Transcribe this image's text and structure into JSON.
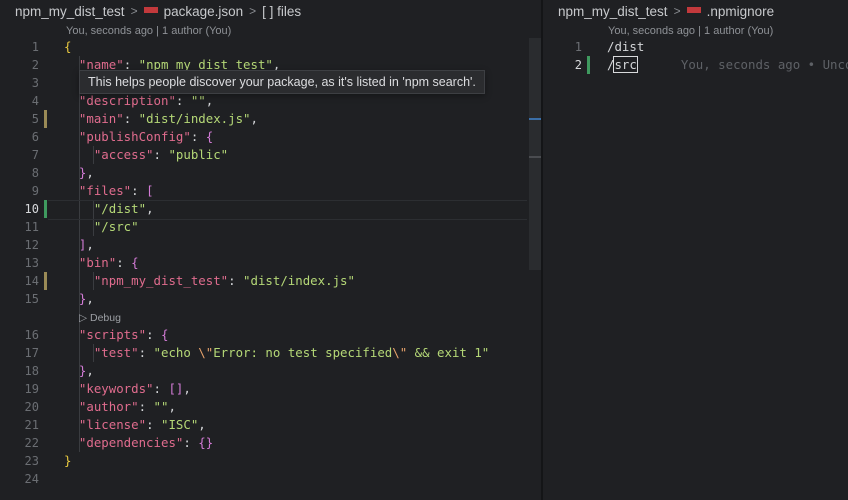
{
  "left": {
    "breadcrumb": {
      "folder": "npm_my_dist_test",
      "file": "package.json",
      "node": "[ ] files"
    },
    "blame_lens": "You, seconds ago | 1 author (You)",
    "hover_text": "This helps people discover your package, as it's listed in 'npm search'.",
    "codelens_debug": "▷ Debug",
    "lines": [
      {
        "n": "1"
      },
      {
        "n": "2"
      },
      {
        "n": "3"
      },
      {
        "n": "4"
      },
      {
        "n": "5"
      },
      {
        "n": "6"
      },
      {
        "n": "7"
      },
      {
        "n": "8"
      },
      {
        "n": "9"
      },
      {
        "n": "10"
      },
      {
        "n": "11"
      },
      {
        "n": "12"
      },
      {
        "n": "13"
      },
      {
        "n": "14"
      },
      {
        "n": "15"
      },
      {
        "n": "16"
      },
      {
        "n": "17"
      },
      {
        "n": "18"
      },
      {
        "n": "19"
      },
      {
        "n": "20"
      },
      {
        "n": "21"
      },
      {
        "n": "22"
      },
      {
        "n": "23"
      },
      {
        "n": "24"
      }
    ],
    "code": {
      "l2_key": "\"name\"",
      "l2_val": "\"npm_my_dist_test\"",
      "l4_key": "\"description\"",
      "l4_val": "\"\"",
      "l5_key": "\"main\"",
      "l5_val": "\"dist/index.js\"",
      "l6_key": "\"publishConfig\"",
      "l7_key": "\"access\"",
      "l7_val": "\"public\"",
      "l9_key": "\"files\"",
      "l10_val": "\"/dist\"",
      "l11_val": "\"/src\"",
      "l13_key": "\"bin\"",
      "l14_key": "\"npm_my_dist_test\"",
      "l14_val": "\"dist/index.js\"",
      "l16_key": "\"scripts\"",
      "l17_key": "\"test\"",
      "l17_val_a": "\"echo ",
      "l17_esc1": "\\\"",
      "l17_val_b": "Error: no test specified",
      "l17_esc2": "\\\"",
      "l17_val_c": " && exit 1\"",
      "l19_key": "\"keywords\"",
      "l20_key": "\"author\"",
      "l20_val": "\"\"",
      "l21_key": "\"license\"",
      "l21_val": "\"ISC\"",
      "l22_key": "\"dependencies\""
    }
  },
  "right": {
    "breadcrumb": {
      "folder": "npm_my_dist_test",
      "file": ".npmignore"
    },
    "blame_lens": "You, seconds ago | 1 author (You)",
    "lines": [
      {
        "n": "1",
        "text": "/dist"
      },
      {
        "n": "2",
        "text_a": "/",
        "text_b": "src"
      }
    ],
    "inline_blame": "You, seconds ago • Unco"
  }
}
